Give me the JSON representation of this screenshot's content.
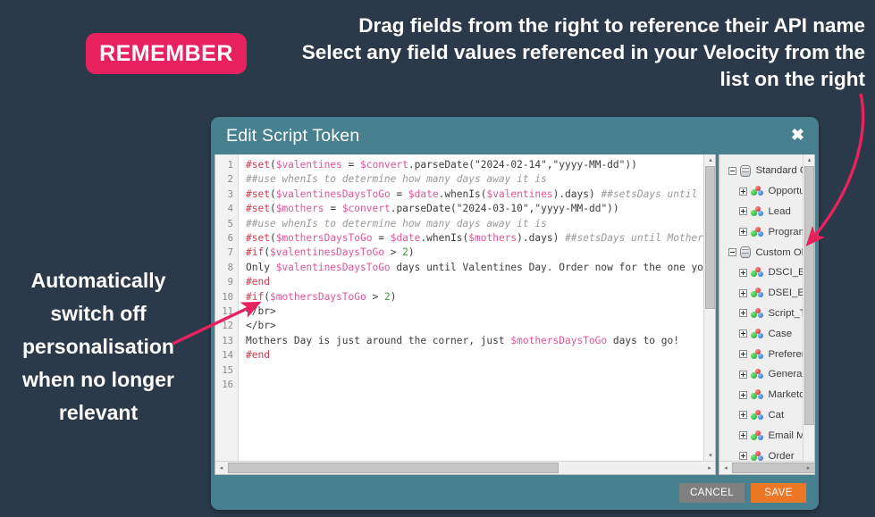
{
  "annotations": {
    "badge_label": "REMEMBER",
    "top_note_lines": [
      "Drag fields from the right to reference their API name",
      "Select any field values referenced in your Velocity from the",
      "list on the right"
    ],
    "left_note_lines": [
      "Automatically",
      "switch off",
      "personalisation",
      "when no longer",
      "relevant"
    ],
    "accent_pink": "#e8215f",
    "background": "#2b3a4a"
  },
  "dialog": {
    "title": "Edit Script Token",
    "close_label": "✖",
    "header_color": "#47808f",
    "footer": {
      "cancel_label": "CANCEL",
      "save_label": "SAVE",
      "cancel_color": "#808080",
      "save_color": "#ec7724"
    }
  },
  "editor": {
    "line_numbers": [
      "1",
      "2",
      "3",
      "4",
      "5",
      "6",
      "7",
      "8",
      "9",
      "10",
      "11",
      "12",
      "13",
      "14",
      "15",
      "16"
    ],
    "lines": [
      "#set($valentines = $convert.parseDate(\"2024-02-14\",\"yyyy-MM-dd\"))",
      "##use whenIs to determine how many days away it is",
      "#set($valentinesDaysToGo = $date.whenIs($valentines).days) ##setsDays until Va",
      "#set($mothers = $convert.parseDate(\"2024-03-10\",\"yyyy-MM-dd\"))",
      "##use whenIs to determine how many days away it is",
      "#set($mothersDaysToGo = $date.whenIs($mothers).days) ##setsDays until Mothers ",
      "#if($valentinesDaysToGo > 2)",
      "Only $valentinesDaysToGo days until Valentines Day. Order now for the one you ",
      "#end",
      "#if($mothersDaysToGo > 2)",
      "</br>",
      "</br>",
      "Mothers Day is just around the corner, just $mothersDaysToGo days to go!",
      "#end",
      "",
      ""
    ]
  },
  "tree": {
    "nodes": [
      {
        "label": "Standard Objects",
        "level": 0,
        "icon": "database-icon",
        "expander": "minus"
      },
      {
        "label": "Opportunity",
        "level": 1,
        "icon": "object-icon",
        "expander": "plus"
      },
      {
        "label": "Lead",
        "level": 1,
        "icon": "object-icon",
        "expander": "plus"
      },
      {
        "label": "Program Membership",
        "level": 1,
        "icon": "object-icon",
        "expander": "plus"
      },
      {
        "label": "Custom Objects",
        "level": 0,
        "icon": "database-icon",
        "expander": "minus"
      },
      {
        "label": "DSCI_Event",
        "level": 1,
        "icon": "object-icon",
        "expander": "plus"
      },
      {
        "label": "DSEI_Event_Collateral",
        "level": 1,
        "icon": "object-icon",
        "expander": "plus"
      },
      {
        "label": "Script_Test",
        "level": 1,
        "icon": "object-icon",
        "expander": "plus"
      },
      {
        "label": "Case",
        "level": 1,
        "icon": "object-icon",
        "expander": "plus"
      },
      {
        "label": "Preference",
        "level": 1,
        "icon": "object-icon",
        "expander": "plus"
      },
      {
        "label": "General_Purpose_Object_Fetc",
        "level": 1,
        "icon": "object-icon",
        "expander": "plus"
      },
      {
        "label": "Marketo Score",
        "level": 1,
        "icon": "object-icon",
        "expander": "plus"
      },
      {
        "label": "Cat",
        "level": 1,
        "icon": "object-icon",
        "expander": "plus"
      },
      {
        "label": "Email Message",
        "level": 1,
        "icon": "object-icon",
        "expander": "plus"
      },
      {
        "label": "Order",
        "level": 1,
        "icon": "object-icon",
        "expander": "plus"
      }
    ]
  },
  "scroll_glyphs": {
    "up": "▴",
    "down": "▾",
    "left": "◂",
    "right": "▸"
  }
}
